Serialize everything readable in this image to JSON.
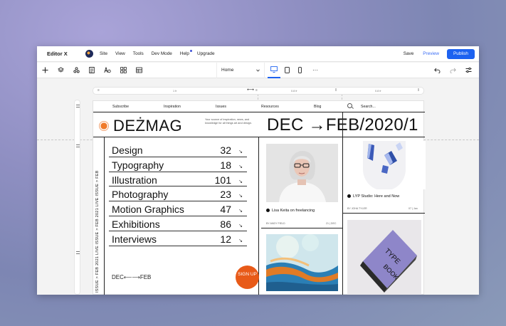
{
  "topbar": {
    "brand": "Editor X",
    "menu": [
      "Site",
      "View",
      "Tools",
      "Dev Mode",
      "Help",
      "Upgrade"
    ],
    "save": "Save",
    "preview": "Preview",
    "publish": "Publish"
  },
  "toolbar": {
    "page": "Home",
    "more": "···"
  },
  "grid_header": {
    "col1": "1 fr",
    "col2": "0.8 fr",
    "col3": "0.8 fr"
  },
  "site": {
    "nav": {
      "subscribe": "Subscribe",
      "inspiration": "Inspiration",
      "issues": "Issues",
      "resources": "Resources",
      "blog": "Blog",
      "search": "Search..."
    },
    "logo": "DEŻMAG",
    "tagline": "Your source of inspiration, news, and knowledge for all things art and design.",
    "headline": "DEC →FEB/2020/1",
    "vertical_text": "ISSUE  >  FEB 2021 LIVE ISSUE  >  FEB 2021 LIVE ISSUE  >  FEB",
    "categories": [
      {
        "name": "Design",
        "count": "32"
      },
      {
        "name": "Typography",
        "count": "18"
      },
      {
        "name": "Illustration",
        "count": "101"
      },
      {
        "name": "Photography",
        "count": "23"
      },
      {
        "name": "Motion Graphics",
        "count": "47"
      },
      {
        "name": "Exhibitions",
        "count": "86"
      },
      {
        "name": "Interviews",
        "count": "12"
      }
    ],
    "dec_feb": "DEC⟵⟶FEB",
    "signup": "SIGN UP",
    "card1": {
      "title": "Lisa Keita on freelancing",
      "author": "BY ANDY FIELD",
      "date": "21 | DEC"
    },
    "card2": {
      "title": "LYP Studio: Here and Now",
      "author": "BY JOHA TYLER",
      "date": "07 | Jan"
    }
  },
  "colors": {
    "accent": "#1d62f0",
    "signup": "#e85a18"
  }
}
